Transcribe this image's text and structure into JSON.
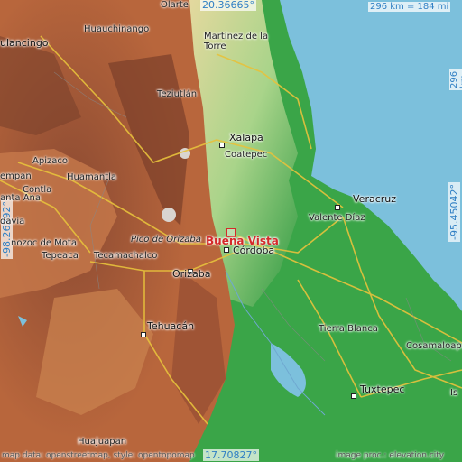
{
  "map": {
    "coords": {
      "top": "20.36665°",
      "bottom": "17.70827°",
      "left": "-98.26292°",
      "right": "-95.45042°"
    },
    "scale": {
      "horizontal": "296 km = 184 mi",
      "vertical": "296 km = 184 mi"
    },
    "target": "Buena Vista",
    "peak": "Pico de Orizaba",
    "places": {
      "olarte": "Olarte",
      "huauchinango": "Huauchinango",
      "martinez": "Martínez de la\nTorre",
      "tlancingo": "ulancingo",
      "teziutlan": "Teziutlán",
      "xalapa": "Xalapa",
      "coatepec": "Coatepec",
      "veracruz": "Veracruz",
      "valente": "Valente Díaz",
      "apizaco": "Apizaco",
      "huamantla": "Huamantla",
      "contla": "Contla",
      "empan": "empan",
      "antaana": "anta Ana",
      "davia": "davia",
      "nozoc": "nozoc de Mota",
      "tepeaca": "Tepeaca",
      "tecamachalco": "Tecamachalco",
      "cordoba": "Córdoba",
      "orizaba": "Orizaba",
      "tehuacan": "Tehuacán",
      "tierrablanca": "Tierra Blanca",
      "cosamaloapa": "Cosamaloapa",
      "tuxtepec": "Tuxtepec",
      "isla": "Is",
      "huajuapan": "Huajuapan"
    },
    "credits": {
      "left": "map data: openstreetmap, style: opentopomap",
      "right": "image proc.: elevation.city"
    },
    "colors": {
      "sea": "#7cc0dc",
      "lowland": "#3aa548",
      "highland": "#b5603a",
      "target": "#d42a2a",
      "coord_text": "#2f7fc4"
    }
  }
}
